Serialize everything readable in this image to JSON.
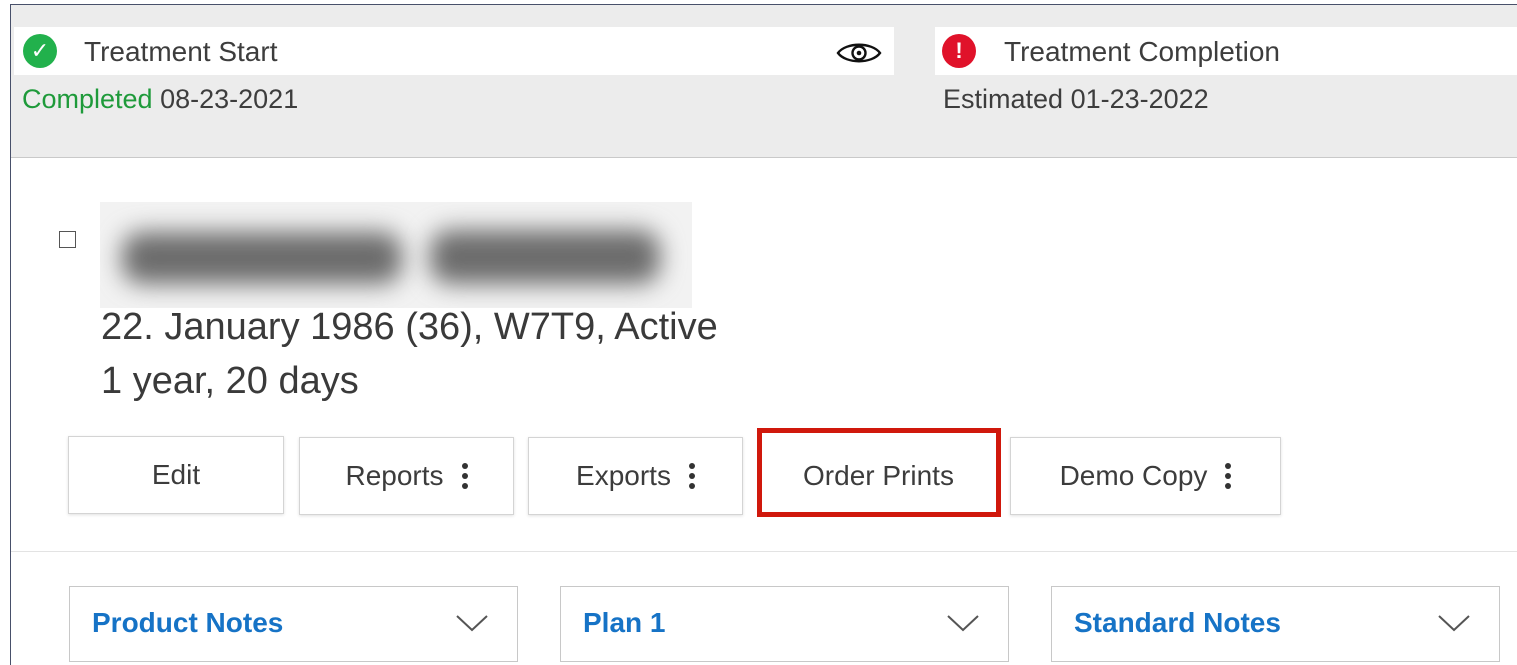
{
  "milestones": {
    "start": {
      "title": "Treatment Start",
      "status": "Completed",
      "date": "08-23-2021",
      "icon": "check-icon",
      "icon_glyph": "✓",
      "color": "#22b14c"
    },
    "completion": {
      "title": "Treatment Completion",
      "status": "Estimated",
      "date": "01-23-2022",
      "icon": "exclamation-icon",
      "icon_glyph": "!",
      "color": "#e0122a"
    }
  },
  "patient": {
    "details": "22. January 1986  (36), W7T9, Active",
    "duration": "1 year, 20 days"
  },
  "actions": {
    "edit": "Edit",
    "reports": "Reports",
    "exports": "Exports",
    "order_prints": "Order Prints",
    "demo_copy": "Demo Copy"
  },
  "dropdowns": {
    "product_notes": "Product Notes",
    "plan": "Plan 1",
    "standard_notes": "Standard Notes"
  },
  "colors": {
    "link_blue": "#1673c6",
    "highlight_red": "#d0180c",
    "completed_green": "#1e9a3a"
  }
}
